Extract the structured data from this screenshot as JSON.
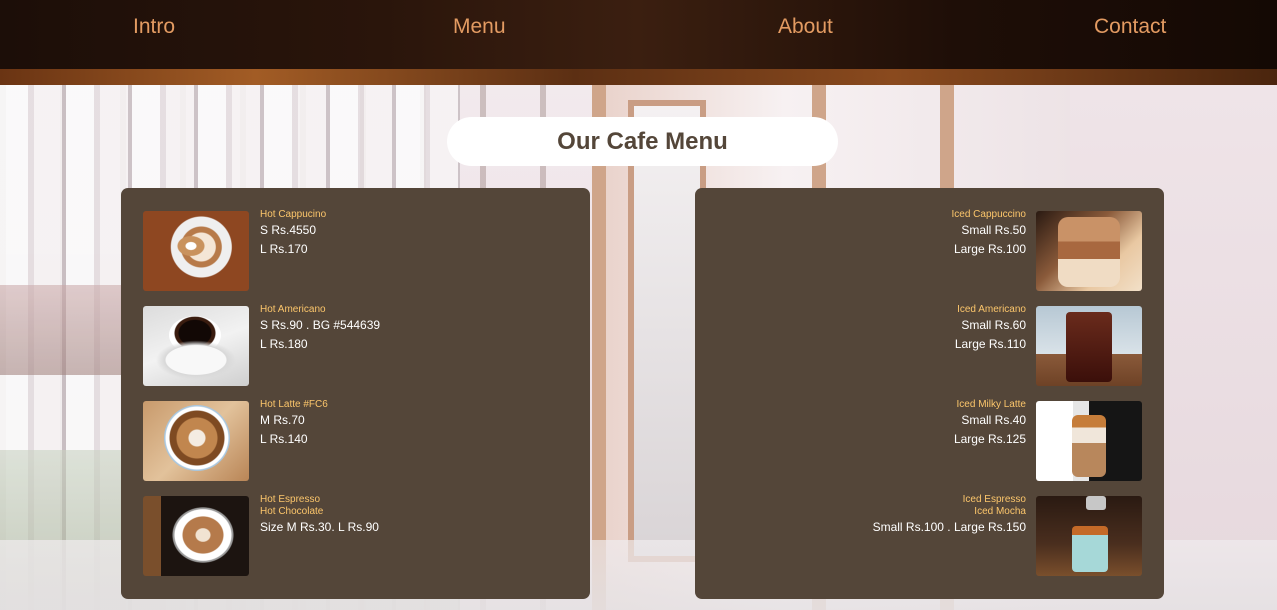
{
  "nav": {
    "items": [
      "Intro",
      "Menu",
      "About",
      "Contact"
    ]
  },
  "title": "Our Cafe Menu",
  "menu": {
    "hot": [
      {
        "name": [
          "Hot Cappucino"
        ],
        "prices": [
          "S Rs.4550",
          "L Rs.170"
        ]
      },
      {
        "name": [
          "Hot Americano"
        ],
        "prices": [
          "S Rs.90 . BG #544639",
          "L Rs.180"
        ]
      },
      {
        "name": [
          "Hot Latte #FC6"
        ],
        "prices": [
          "M Rs.70",
          "L Rs.140"
        ]
      },
      {
        "name": [
          "Hot Espresso",
          "Hot Chocolate"
        ],
        "prices": [
          "Size M Rs.30. L Rs.90"
        ]
      }
    ],
    "iced": [
      {
        "name": [
          "Iced Cappuccino"
        ],
        "prices": [
          "Small Rs.50",
          "Large Rs.100"
        ]
      },
      {
        "name": [
          "Iced Americano"
        ],
        "prices": [
          "Small Rs.60",
          "Large Rs.110"
        ]
      },
      {
        "name": [
          "Iced Milky Latte"
        ],
        "prices": [
          "Small Rs.40",
          "Large Rs.125"
        ]
      },
      {
        "name": [
          "Iced Espresso",
          "Iced Mocha"
        ],
        "prices": [
          "Small Rs.100 . Large Rs.150"
        ]
      }
    ]
  },
  "colors": {
    "panel_bg": "#544639",
    "item_name": "#FCC66B",
    "nav_text": "#E39B62",
    "title_text": "#544639"
  }
}
